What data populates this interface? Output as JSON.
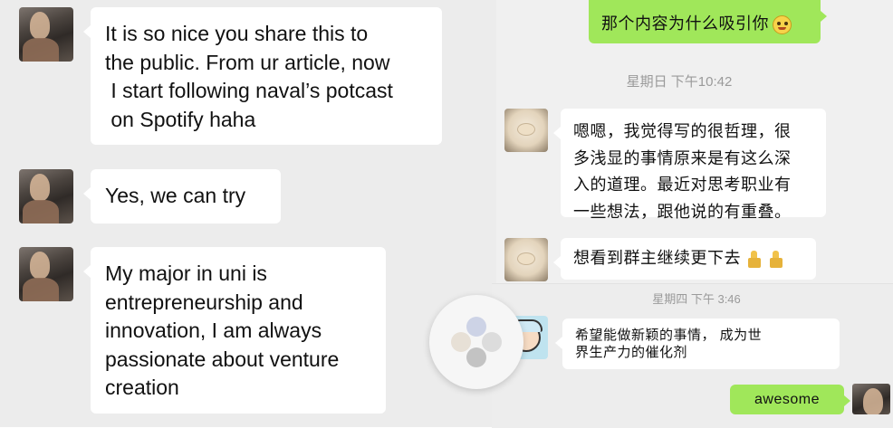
{
  "left_chat": {
    "messages": [
      {
        "text_lines": [
          "It is so nice you share this to",
          "the public. From ur article, now",
          " I start following naval’s potcast",
          " on Spotify haha"
        ]
      },
      {
        "text_lines": [
          "Yes, we can try"
        ]
      },
      {
        "text_lines": [
          "My major in uni is",
          "entrepreneurship and",
          "innovation, I am always",
          "passionate about venture",
          "creation"
        ]
      }
    ]
  },
  "right_chat": {
    "top_sent": {
      "text": "那个内容为什么吸引你",
      "emoji": "blush-emoji"
    },
    "timestamp_1": "星期日 下午10:42",
    "msg_1_lines": [
      "嗯嗯，我觉得写的很哲理，很",
      "多浅显的事情原来是有这么深",
      "入的道理。最近对思考职业有",
      "一些想法，跟他说的有重叠。"
    ],
    "msg_2": {
      "text": "想看到群主继续更下去",
      "emoji": "thumbs-up-emoji"
    },
    "timestamp_2": "星期四 下午 3:46",
    "msg_3_lines": [
      "希望能做新颖的事情， 成为世",
      "界生产力的催化剂"
    ],
    "sent_awesome": "awesome"
  },
  "colors": {
    "sent_bubble": "#a0e75a",
    "received_bubble": "#ffffff",
    "chat_bg": "#ececec",
    "timestamp": "#9a9a9a"
  }
}
